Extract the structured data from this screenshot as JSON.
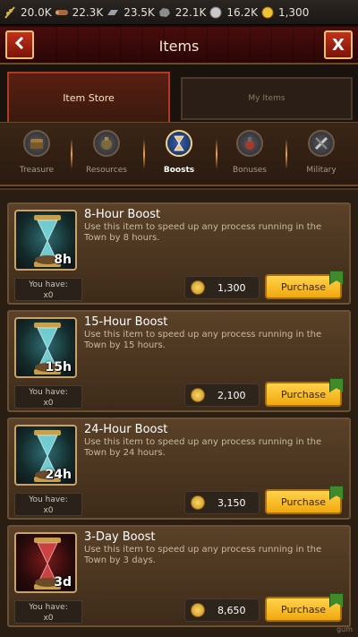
{
  "resources": [
    {
      "icon": "wheat-icon",
      "value": "20.0K",
      "color": "#d7b04a"
    },
    {
      "icon": "wood-icon",
      "value": "22.3K",
      "color": "#a86a3a"
    },
    {
      "icon": "iron-icon",
      "value": "23.5K",
      "color": "#9aa0a6"
    },
    {
      "icon": "stone-icon",
      "value": "22.1K",
      "color": "#8c8c8c"
    },
    {
      "icon": "silver-icon",
      "value": "16.2K",
      "color": "#c9c9c9"
    },
    {
      "icon": "gold-icon",
      "value": "1,300",
      "color": "#f0c23a"
    }
  ],
  "header": {
    "title": "Items",
    "back_icon": "back-chevron-icon",
    "close_label": "X"
  },
  "tabs": {
    "store": "Item Store",
    "mine": "My Items"
  },
  "categories": [
    {
      "label": "Treasure",
      "icon": "treasure-chest-icon",
      "active": false
    },
    {
      "label": "Resources",
      "icon": "resources-bag-icon",
      "active": false
    },
    {
      "label": "Boosts",
      "icon": "hourglass-icon",
      "active": true
    },
    {
      "label": "Bonuses",
      "icon": "potion-icon",
      "active": false
    },
    {
      "label": "Military",
      "icon": "weapon-icon",
      "active": false
    }
  ],
  "items": [
    {
      "name": "8-Hour Boost",
      "description": "Use this item to speed up any process running in the Town by 8 hours.",
      "duration_badge": "8h",
      "have_label": "You have:",
      "have_value": "x0",
      "price": "1,300",
      "purchase_label": "Purchase",
      "theme": "teal"
    },
    {
      "name": "15-Hour Boost",
      "description": "Use this item to speed up any process running in the Town by 15 hours.",
      "duration_badge": "15h",
      "have_label": "You have:",
      "have_value": "x0",
      "price": "2,100",
      "purchase_label": "Purchase",
      "theme": "teal"
    },
    {
      "name": "24-Hour Boost",
      "description": "Use this item to speed up any process running in the Town by 24 hours.",
      "duration_badge": "24h",
      "have_label": "You have:",
      "have_value": "x0",
      "price": "3,150",
      "purchase_label": "Purchase",
      "theme": "teal"
    },
    {
      "name": "3-Day Boost",
      "description": "Use this item to speed up any process running in the Town by 3 days.",
      "duration_badge": "3d",
      "have_label": "You have:",
      "have_value": "x0",
      "price": "8,650",
      "purchase_label": "Purchase",
      "theme": "red"
    }
  ],
  "footer": {
    "mark": "gum"
  }
}
